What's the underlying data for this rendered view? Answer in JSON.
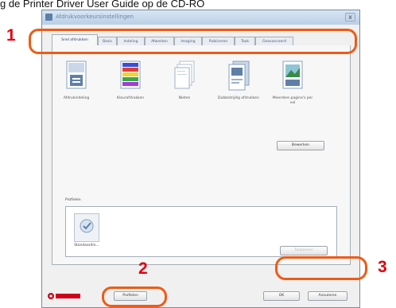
{
  "header_caption": "g de Printer Driver User Guide op de CD-RO",
  "window": {
    "title": "Afdrukvoorkeursinstellingen",
    "close_glyph": "x"
  },
  "tabs": [
    {
      "label": "Snel afdrukken",
      "active": true
    },
    {
      "label": "Basis"
    },
    {
      "label": "Indeling"
    },
    {
      "label": "Afwerken"
    },
    {
      "label": "Imaging"
    },
    {
      "label": "Publiceren"
    },
    {
      "label": "Taak"
    },
    {
      "label": "Geavanceerd"
    }
  ],
  "quick_icons": [
    {
      "name": "document-icon",
      "label": "Afdrukindeling"
    },
    {
      "name": "color-bars-icon",
      "label": "Kleurafdrukken"
    },
    {
      "name": "page-stack-icon",
      "label": "Nieten"
    },
    {
      "name": "duplex-icon",
      "label": "Dubbelzijdig afdrukken"
    },
    {
      "name": "photo-icon",
      "label": "Meerdere pagina's per vel"
    }
  ],
  "edit_button": "Bewerken",
  "presets_label": "Profielen",
  "presets": [
    {
      "label": "Standaardin..."
    }
  ],
  "apply_button": "Toepassen",
  "profiles_button": "Profielen",
  "ok_button": "OK",
  "cancel_button": "Annuleren",
  "brand": "KYOCERA",
  "callouts": [
    "1",
    "2",
    "3"
  ],
  "colors": {
    "callout_circle": "#f05a16",
    "callout_number": "#e2000f",
    "brand_red": "#d0021b"
  }
}
